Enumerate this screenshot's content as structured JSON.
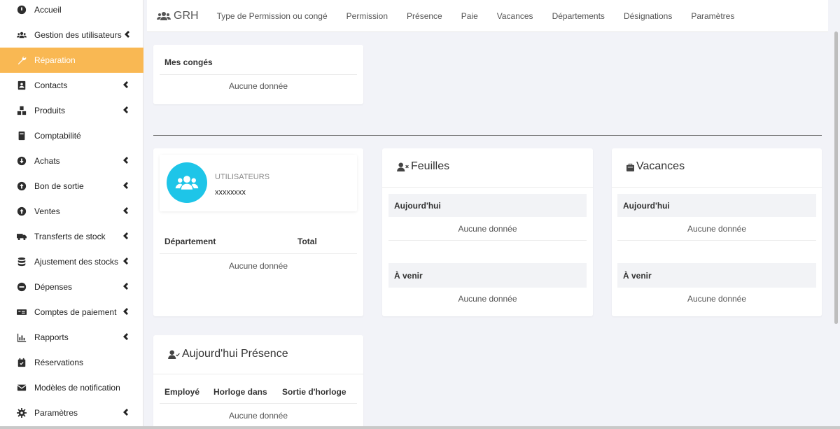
{
  "sidebar": {
    "items": [
      {
        "label": "Accueil",
        "icon": "dashboard-icon",
        "chevron": false,
        "active": false
      },
      {
        "label": "Gestion des utilisateurs",
        "icon": "users-icon",
        "chevron": true,
        "active": false
      },
      {
        "label": "Réparation",
        "icon": "wrench-icon",
        "chevron": false,
        "active": true
      },
      {
        "label": "Contacts",
        "icon": "address-book-icon",
        "chevron": true,
        "active": false
      },
      {
        "label": "Produits",
        "icon": "cubes-icon",
        "chevron": true,
        "active": false
      },
      {
        "label": "Comptabilité",
        "icon": "book-icon",
        "chevron": false,
        "active": false
      },
      {
        "label": "Achats",
        "icon": "arrow-circle-down-icon",
        "chevron": true,
        "active": false
      },
      {
        "label": "Bon de sortie",
        "icon": "arrow-circle-up-icon",
        "chevron": true,
        "active": false
      },
      {
        "label": "Ventes",
        "icon": "arrow-circle-up-icon",
        "chevron": true,
        "active": false
      },
      {
        "label": "Transferts de stock",
        "icon": "truck-icon",
        "chevron": true,
        "active": false
      },
      {
        "label": "Ajustement des stocks",
        "icon": "database-icon",
        "chevron": true,
        "active": false
      },
      {
        "label": "Dépenses",
        "icon": "minus-circle-icon",
        "chevron": true,
        "active": false
      },
      {
        "label": "Comptes de paiement",
        "icon": "money-bill-icon",
        "chevron": true,
        "active": false
      },
      {
        "label": "Rapports",
        "icon": "bar-chart-icon",
        "chevron": true,
        "active": false
      },
      {
        "label": "Réservations",
        "icon": "calendar-check-icon",
        "chevron": false,
        "active": false
      },
      {
        "label": "Modèles de notification",
        "icon": "envelope-icon",
        "chevron": false,
        "active": false
      },
      {
        "label": "Paramètres",
        "icon": "cog-icon",
        "chevron": true,
        "active": false
      }
    ]
  },
  "topnav": {
    "brand": "GRH",
    "links": [
      "Type de Permission ou congé",
      "Permission",
      "Présence",
      "Paie",
      "Vacances",
      "Départements",
      "Désignations",
      "Paramètres"
    ]
  },
  "my_leaves": {
    "title": "Mes congés",
    "empty": "Aucune donnée"
  },
  "users_card": {
    "label": "UTILISATEURS",
    "value": "xxxxxxxx",
    "col_department": "Département",
    "col_total": "Total",
    "empty": "Aucune donnée"
  },
  "leaves_card": {
    "title": "Feuilles",
    "today": "Aujourd'hui",
    "today_empty": "Aucune donnée",
    "upcoming": "À venir",
    "upcoming_empty": "Aucune donnée"
  },
  "holidays_card": {
    "title": "Vacances",
    "today": "Aujourd'hui",
    "today_empty": "Aucune donnée",
    "upcoming": "À venir",
    "upcoming_empty": "Aucune donnée"
  },
  "attendance_card": {
    "title": "Aujourd'hui Présence",
    "col_employee": "Employé",
    "col_clock_in": "Horloge dans",
    "col_clock_out": "Sortie d'horloge",
    "empty": "Aucune donnée"
  },
  "colors": {
    "active": "#f9b853",
    "avatar": "#1ec5e8"
  }
}
